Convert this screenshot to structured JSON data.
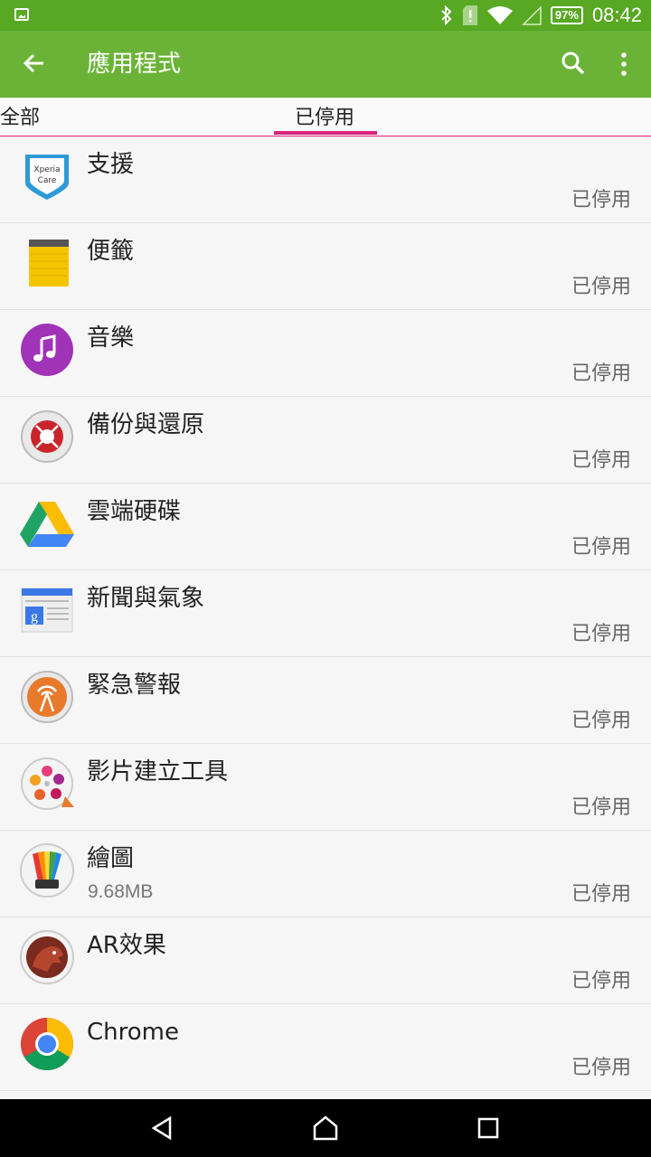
{
  "status": {
    "battery": "97%",
    "time": "08:42"
  },
  "appbar": {
    "title": "應用程式"
  },
  "tabs": [
    {
      "label": "全部"
    },
    {
      "label": "已停用"
    }
  ],
  "apps": [
    {
      "name": "支援",
      "size": "",
      "state": "已停用",
      "icon": "xperia-care-icon"
    },
    {
      "name": "便籤",
      "size": "",
      "state": "已停用",
      "icon": "notepad-icon"
    },
    {
      "name": "音樂",
      "size": "",
      "state": "已停用",
      "icon": "music-icon"
    },
    {
      "name": "備份與還原",
      "size": "",
      "state": "已停用",
      "icon": "backup-restore-icon"
    },
    {
      "name": "雲端硬碟",
      "size": "",
      "state": "已停用",
      "icon": "google-drive-icon"
    },
    {
      "name": "新聞與氣象",
      "size": "",
      "state": "已停用",
      "icon": "news-weather-icon"
    },
    {
      "name": "緊急警報",
      "size": "",
      "state": "已停用",
      "icon": "emergency-alert-icon"
    },
    {
      "name": "影片建立工具",
      "size": "",
      "state": "已停用",
      "icon": "movie-creator-icon"
    },
    {
      "name": "繪圖",
      "size": "9.68MB",
      "state": "已停用",
      "icon": "sketch-icon"
    },
    {
      "name": "AR效果",
      "size": "",
      "state": "已停用",
      "icon": "ar-effect-icon"
    },
    {
      "name": "Chrome",
      "size": "",
      "state": "已停用",
      "icon": "chrome-icon"
    }
  ]
}
